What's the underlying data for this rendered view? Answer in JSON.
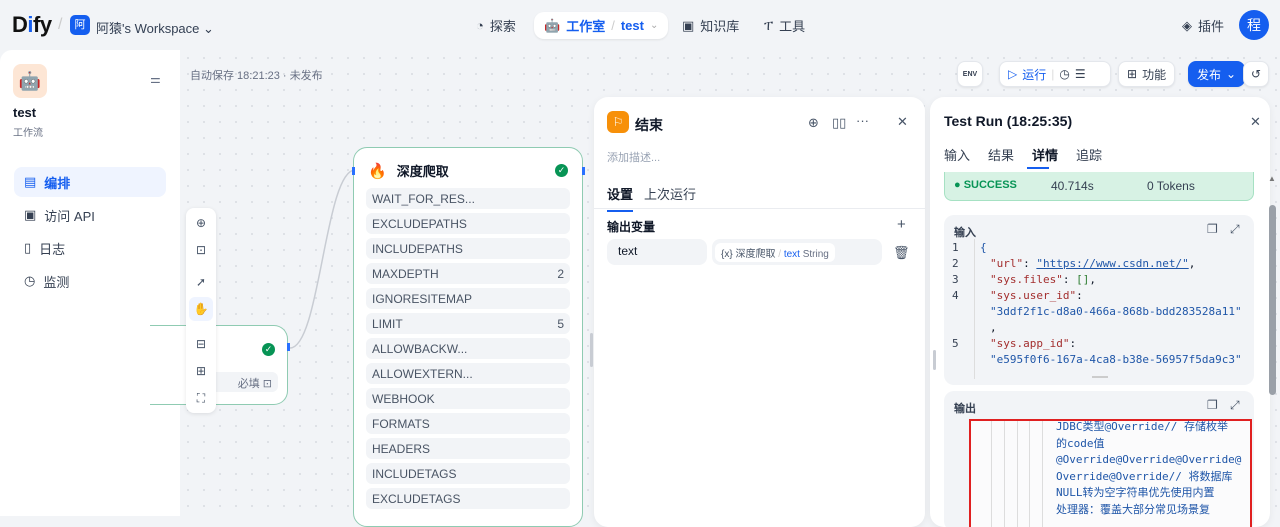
{
  "header": {
    "logo": "Dify",
    "workspace_badge": "阿",
    "workspace": "阿猿's Workspace",
    "nav": [
      {
        "label": "探索"
      },
      {
        "label": "工作室"
      },
      {
        "label": "知识库"
      },
      {
        "label": "工具"
      }
    ],
    "breadcrumb_app": "test",
    "plugins": "插件",
    "avatar": "程"
  },
  "sidebar": {
    "app_name": "test",
    "app_type": "工作流",
    "items": [
      {
        "label": "编排"
      },
      {
        "label": "访问 API"
      },
      {
        "label": "日志"
      },
      {
        "label": "监测"
      }
    ]
  },
  "canvas": {
    "autosave": "自动保存 18:21:23 · 未发布",
    "toolbar": {
      "env": "ENV",
      "run": "运行",
      "features": "功能",
      "publish": "发布"
    },
    "start_node": {
      "required": "必填"
    },
    "crawl_node": {
      "title": "深度爬取",
      "fields": [
        {
          "name": "WAIT_FOR_RES...",
          "value": ""
        },
        {
          "name": "EXCLUDEPATHS",
          "value": ""
        },
        {
          "name": "INCLUDEPATHS",
          "value": ""
        },
        {
          "name": "MAXDEPTH",
          "value": "2"
        },
        {
          "name": "IGNORESITEMAP",
          "value": ""
        },
        {
          "name": "LIMIT",
          "value": "5"
        },
        {
          "name": "ALLOWBACKW...",
          "value": ""
        },
        {
          "name": "ALLOWEXTERN...",
          "value": ""
        },
        {
          "name": "WEBHOOK",
          "value": ""
        },
        {
          "name": "FORMATS",
          "value": ""
        },
        {
          "name": "HEADERS",
          "value": ""
        },
        {
          "name": "INCLUDETAGS",
          "value": ""
        },
        {
          "name": "EXCLUDETAGS",
          "value": ""
        }
      ]
    }
  },
  "end_panel": {
    "title": "结束",
    "description_placeholder": "添加描述...",
    "tabs": [
      "设置",
      "上次运行"
    ],
    "section": "输出变量",
    "var_name": "text",
    "var_source_node": "深度爬取",
    "var_source_name": "text",
    "var_type": "String"
  },
  "test_run": {
    "title": "Test Run (18:25:35)",
    "tabs": [
      "输入",
      "结果",
      "详情",
      "追踪"
    ],
    "status": "SUCCESS",
    "elapsed": "40.714s",
    "tokens": "0 Tokens",
    "input_label": "输入",
    "input_lines": [
      {
        "n": "1",
        "text": "{"
      },
      {
        "n": "2",
        "key": "\"url\"",
        "value": "\"https://www.csdn.net/\"",
        "tail": ","
      },
      {
        "n": "3",
        "key": "\"sys.files\"",
        "value": "[]",
        "tail": ","
      },
      {
        "n": "4",
        "key": "\"sys.user_id\"",
        "value": "\"3ddf2f1c-d8a0-466a-868b-bdd283528a11\"",
        "tail": ","
      },
      {
        "n": "5",
        "key": "\"sys.app_id\"",
        "value": "\"e595f0f6-167a-4ca8-b38e-56957f5da9c3\""
      }
    ],
    "output_label": "输出",
    "output_lines": [
      "JDBC类型@Override// 存储枚举",
      "的code值",
      "@Override@Override@Override@",
      "Override@Override// 将数据库",
      "NULL转为空字符串优先使用内置",
      "处理器：覆盖大部分常见场景复"
    ]
  }
}
